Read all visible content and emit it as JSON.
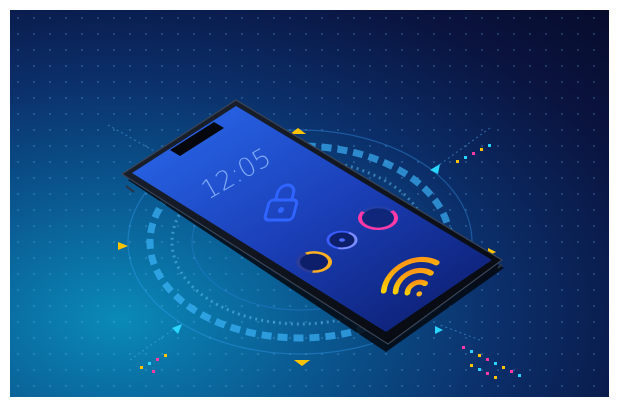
{
  "phone": {
    "time": "12:05"
  },
  "icons": {
    "lock": "padlock-icon",
    "wifi": "wifi-icon"
  },
  "colors": {
    "background_dark": "#070c2c",
    "background_cyan": "#0a8ab8",
    "screen_blue": "#1a4fd8",
    "accent_orange": "#ffb020",
    "accent_magenta": "#ff3aa8",
    "accent_yellow": "#ffc400",
    "accent_cyan": "#2ad4ff"
  }
}
